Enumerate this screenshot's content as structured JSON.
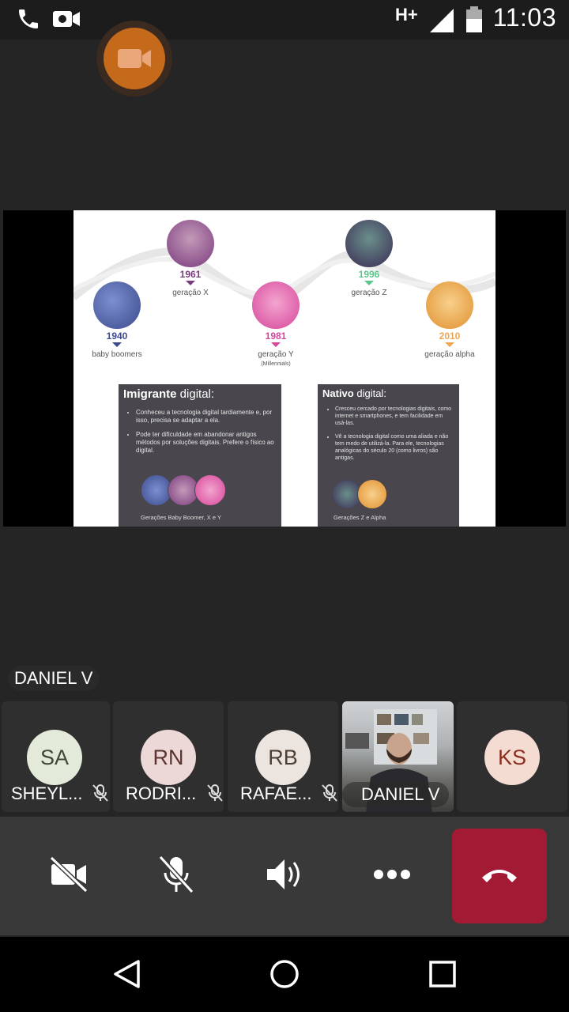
{
  "status_bar": {
    "time": "11:03",
    "network": "H+",
    "icons": [
      "phone-icon",
      "video-call-icon",
      "signal-icon",
      "battery-icon"
    ]
  },
  "floating_button": {
    "icon": "video-camera-icon",
    "color": "#c56a1a"
  },
  "shared_slide": {
    "generations": [
      {
        "year": "1940",
        "label": "baby boomers",
        "sub": "",
        "color": "#3b4a8c"
      },
      {
        "year": "1961",
        "label": "geração X",
        "sub": "",
        "color": "#7a3a7e"
      },
      {
        "year": "1981",
        "label": "geração Y",
        "sub": "(Millennials)",
        "color": "#d6459b"
      },
      {
        "year": "1996",
        "label": "geração Z",
        "sub": "",
        "color": "#5cc58f"
      },
      {
        "year": "2010",
        "label": "geração alpha",
        "sub": "",
        "color": "#f0a650"
      }
    ],
    "immigrant": {
      "title_bold": "Imigrante",
      "title_rest": " digital:",
      "bullets": [
        "Conheceu a tecnologia digital tardiamente e, por isso, precisa se adaptar a ela.",
        "Pode ter dificuldade em abandonar antigos métodos por soluções digitais. Prefere o físico ao digital."
      ],
      "caption": "Gerações Baby Boomer, X e Y"
    },
    "native": {
      "title_bold": "Nativo",
      "title_rest": " digital:",
      "bullets": [
        "Cresceu cercado por tecnologias digitais, como internet e smartphones, e tem facilidade em usá-las.",
        "Vê a tecnologia digital como uma aliada e não tem medo de utilizá-la. Para ele, tecnologias analógicas do século 20 (como livros) são antigas."
      ],
      "caption": "Gerações Z e Alpha"
    }
  },
  "speaker_label": "DANIEL V",
  "participants": [
    {
      "initials": "SA",
      "name": "SHEYL...",
      "muted": true,
      "avatar_bg": "#e3ead9",
      "avatar_fg": "#3d4a33"
    },
    {
      "initials": "RN",
      "name": "RODRI...",
      "muted": true,
      "avatar_bg": "#ecd9d7",
      "avatar_fg": "#5a3330"
    },
    {
      "initials": "RB",
      "name": "RAFAE...",
      "muted": true,
      "avatar_bg": "#ece4de",
      "avatar_fg": "#4e3f34"
    },
    {
      "initials": "",
      "name": "DANIEL V",
      "muted": false,
      "video": true
    },
    {
      "initials": "KS",
      "name": "",
      "muted": false,
      "avatar_bg": "#f5dcd2",
      "avatar_fg": "#8a2e1e"
    }
  ],
  "controls": {
    "video_off_icon": "video-off-icon",
    "mic_off_icon": "mic-off-icon",
    "speaker_icon": "speaker-icon",
    "more_icon": "more-icon",
    "hangup_icon": "hang-up-icon",
    "hangup_color": "#a31a35"
  },
  "nav": [
    "back-icon",
    "home-icon",
    "recents-icon"
  ]
}
